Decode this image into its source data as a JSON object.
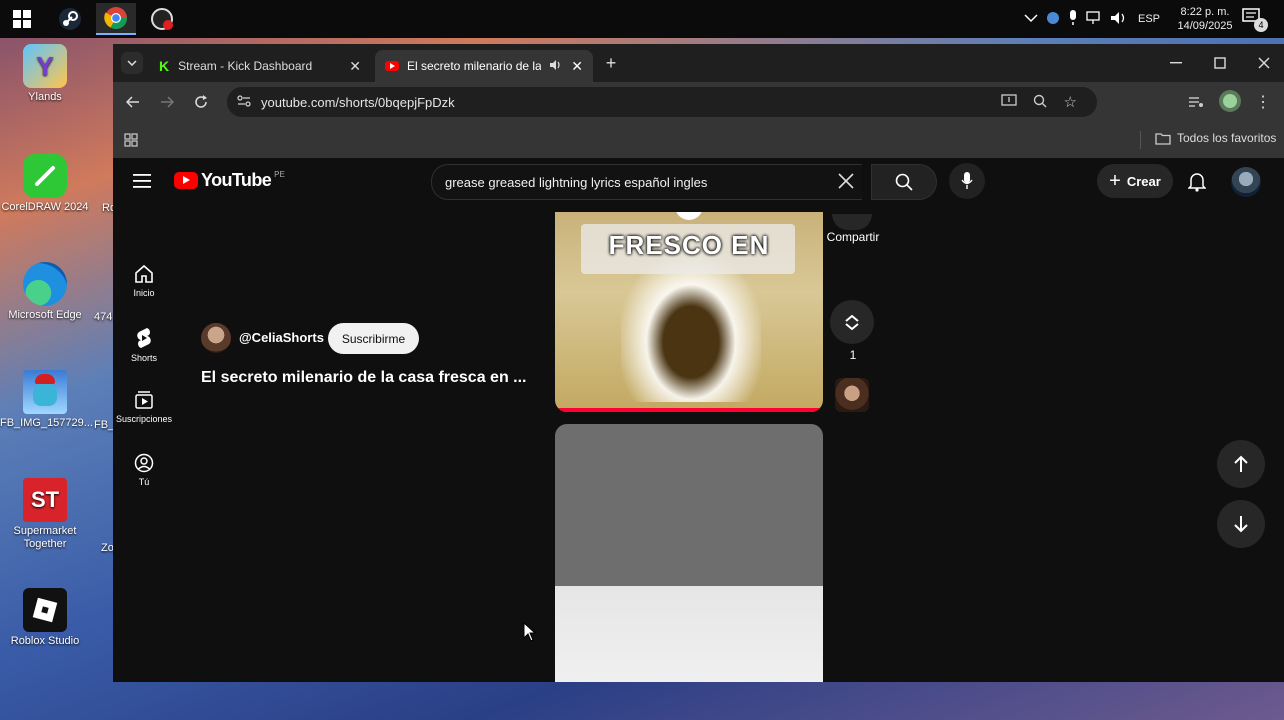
{
  "taskbar": {
    "language": "ESP",
    "time": "8:22 p. m.",
    "date": "14/09/2025",
    "notification_count": "4"
  },
  "desktop": {
    "icons": [
      {
        "label": "Ylands"
      },
      {
        "label": "CorelDRAW 2024"
      },
      {
        "label": "Microsoft Edge"
      },
      {
        "label": "FB_IMG_157729..."
      },
      {
        "label": "Supermarket Together"
      },
      {
        "label": "Roblox Studio"
      }
    ],
    "partial_labels": [
      "Ro",
      "474",
      "FB_I",
      "Zo"
    ]
  },
  "browser": {
    "tabs": [
      {
        "title": "Stream - Kick Dashboard"
      },
      {
        "title": "El secreto milenario de la ca"
      }
    ],
    "url": "youtube.com/shorts/0bqepjFpDzk",
    "bookmarks_folder": "Todos los favoritos"
  },
  "youtube": {
    "logo_text": "YouTube",
    "region": "PE",
    "search_query": "grease greased lightning lyrics español ingles",
    "create_label": "Crear",
    "nav": [
      {
        "label": "Inicio",
        "icon": "home-icon"
      },
      {
        "label": "Shorts",
        "icon": "shorts-icon"
      },
      {
        "label": "Suscripciones",
        "icon": "subscriptions-icon"
      },
      {
        "label": "Tú",
        "icon": "you-icon"
      }
    ],
    "channel": "@CeliaShorts",
    "subscribe_label": "Suscribirme",
    "video_title": "El secreto milenario de la casa fresca en ...",
    "thumbnail_caption": "FRESCO EN",
    "share_label": "Compartir",
    "remix_count": "1",
    "colors": {
      "brand_red": "#ff0000",
      "progress_red": "#ff0033",
      "page_bg": "#0f0f0f"
    }
  }
}
